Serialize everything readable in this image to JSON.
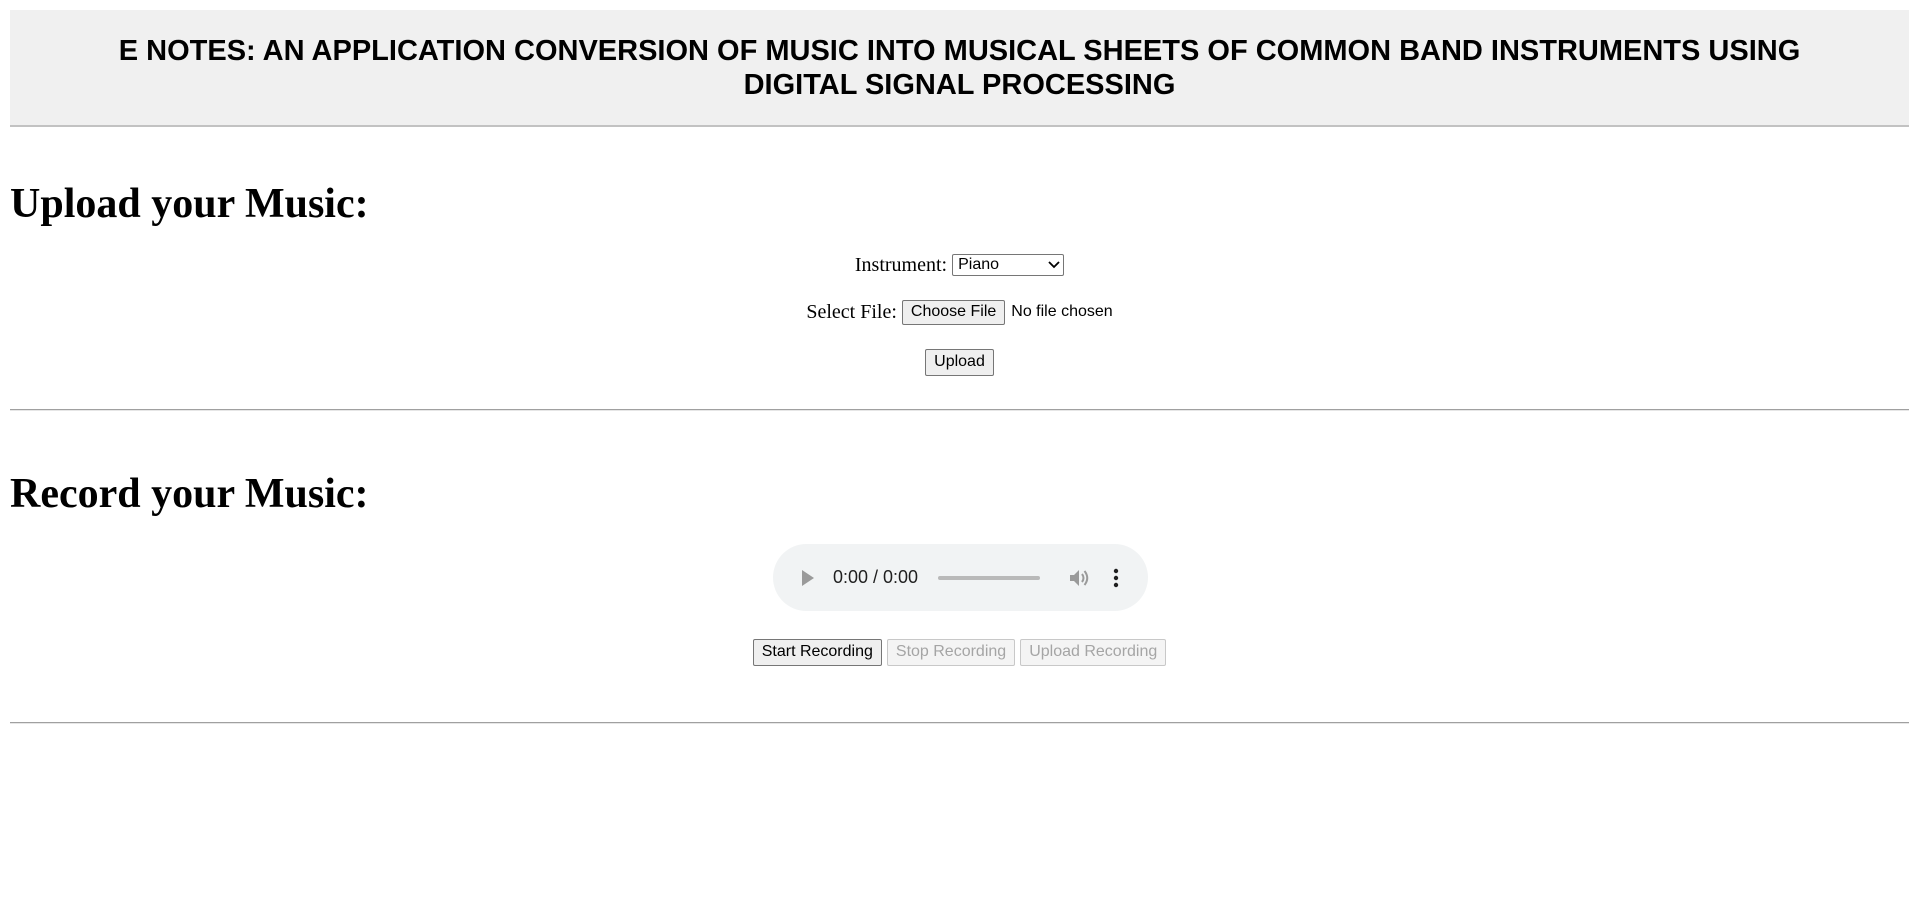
{
  "header": {
    "title": "E NOTES: AN APPLICATION CONVERSION OF MUSIC INTO MUSICAL SHEETS OF COMMON BAND INSTRUMENTS USING DIGITAL SIGNAL PROCESSING"
  },
  "upload_section": {
    "title": "Upload your Music:",
    "instrument_label": "Instrument:",
    "instrument_selected": "Piano",
    "file_label": "Select File:",
    "choose_file_label": "Choose File",
    "file_status": "No file chosen",
    "upload_label": "Upload"
  },
  "record_section": {
    "title": "Record your Music:",
    "player": {
      "time": "0:00 / 0:00",
      "progress": 0
    },
    "start_label": "Start Recording",
    "stop_label": "Stop Recording",
    "upload_recording_label": "Upload Recording"
  },
  "colors": {
    "header_bg": "#f0f0f0",
    "button_bg": "#efefef",
    "disabled_text": "#a5a5a5",
    "player_bg": "#f1f3f4"
  }
}
